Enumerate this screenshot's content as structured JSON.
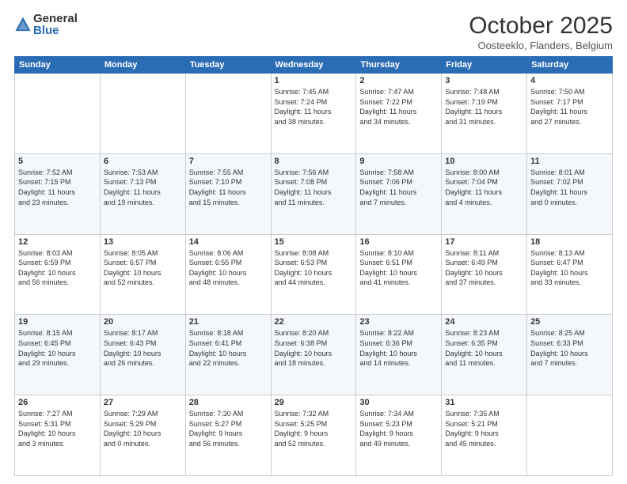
{
  "logo": {
    "general": "General",
    "blue": "Blue"
  },
  "header": {
    "month": "October 2025",
    "location": "Oosteeklo, Flanders, Belgium"
  },
  "weekdays": [
    "Sunday",
    "Monday",
    "Tuesday",
    "Wednesday",
    "Thursday",
    "Friday",
    "Saturday"
  ],
  "weeks": [
    [
      {
        "day": "",
        "info": ""
      },
      {
        "day": "",
        "info": ""
      },
      {
        "day": "",
        "info": ""
      },
      {
        "day": "1",
        "info": "Sunrise: 7:45 AM\nSunset: 7:24 PM\nDaylight: 11 hours\nand 38 minutes."
      },
      {
        "day": "2",
        "info": "Sunrise: 7:47 AM\nSunset: 7:22 PM\nDaylight: 11 hours\nand 34 minutes."
      },
      {
        "day": "3",
        "info": "Sunrise: 7:48 AM\nSunset: 7:19 PM\nDaylight: 11 hours\nand 31 minutes."
      },
      {
        "day": "4",
        "info": "Sunrise: 7:50 AM\nSunset: 7:17 PM\nDaylight: 11 hours\nand 27 minutes."
      }
    ],
    [
      {
        "day": "5",
        "info": "Sunrise: 7:52 AM\nSunset: 7:15 PM\nDaylight: 11 hours\nand 23 minutes."
      },
      {
        "day": "6",
        "info": "Sunrise: 7:53 AM\nSunset: 7:13 PM\nDaylight: 11 hours\nand 19 minutes."
      },
      {
        "day": "7",
        "info": "Sunrise: 7:55 AM\nSunset: 7:10 PM\nDaylight: 11 hours\nand 15 minutes."
      },
      {
        "day": "8",
        "info": "Sunrise: 7:56 AM\nSunset: 7:08 PM\nDaylight: 11 hours\nand 11 minutes."
      },
      {
        "day": "9",
        "info": "Sunrise: 7:58 AM\nSunset: 7:06 PM\nDaylight: 11 hours\nand 7 minutes."
      },
      {
        "day": "10",
        "info": "Sunrise: 8:00 AM\nSunset: 7:04 PM\nDaylight: 11 hours\nand 4 minutes."
      },
      {
        "day": "11",
        "info": "Sunrise: 8:01 AM\nSunset: 7:02 PM\nDaylight: 11 hours\nand 0 minutes."
      }
    ],
    [
      {
        "day": "12",
        "info": "Sunrise: 8:03 AM\nSunset: 6:59 PM\nDaylight: 10 hours\nand 56 minutes."
      },
      {
        "day": "13",
        "info": "Sunrise: 8:05 AM\nSunset: 6:57 PM\nDaylight: 10 hours\nand 52 minutes."
      },
      {
        "day": "14",
        "info": "Sunrise: 8:06 AM\nSunset: 6:55 PM\nDaylight: 10 hours\nand 48 minutes."
      },
      {
        "day": "15",
        "info": "Sunrise: 8:08 AM\nSunset: 6:53 PM\nDaylight: 10 hours\nand 44 minutes."
      },
      {
        "day": "16",
        "info": "Sunrise: 8:10 AM\nSunset: 6:51 PM\nDaylight: 10 hours\nand 41 minutes."
      },
      {
        "day": "17",
        "info": "Sunrise: 8:11 AM\nSunset: 6:49 PM\nDaylight: 10 hours\nand 37 minutes."
      },
      {
        "day": "18",
        "info": "Sunrise: 8:13 AM\nSunset: 6:47 PM\nDaylight: 10 hours\nand 33 minutes."
      }
    ],
    [
      {
        "day": "19",
        "info": "Sunrise: 8:15 AM\nSunset: 6:45 PM\nDaylight: 10 hours\nand 29 minutes."
      },
      {
        "day": "20",
        "info": "Sunrise: 8:17 AM\nSunset: 6:43 PM\nDaylight: 10 hours\nand 26 minutes."
      },
      {
        "day": "21",
        "info": "Sunrise: 8:18 AM\nSunset: 6:41 PM\nDaylight: 10 hours\nand 22 minutes."
      },
      {
        "day": "22",
        "info": "Sunrise: 8:20 AM\nSunset: 6:38 PM\nDaylight: 10 hours\nand 18 minutes."
      },
      {
        "day": "23",
        "info": "Sunrise: 8:22 AM\nSunset: 6:36 PM\nDaylight: 10 hours\nand 14 minutes."
      },
      {
        "day": "24",
        "info": "Sunrise: 8:23 AM\nSunset: 6:35 PM\nDaylight: 10 hours\nand 11 minutes."
      },
      {
        "day": "25",
        "info": "Sunrise: 8:25 AM\nSunset: 6:33 PM\nDaylight: 10 hours\nand 7 minutes."
      }
    ],
    [
      {
        "day": "26",
        "info": "Sunrise: 7:27 AM\nSunset: 5:31 PM\nDaylight: 10 hours\nand 3 minutes."
      },
      {
        "day": "27",
        "info": "Sunrise: 7:29 AM\nSunset: 5:29 PM\nDaylight: 10 hours\nand 0 minutes."
      },
      {
        "day": "28",
        "info": "Sunrise: 7:30 AM\nSunset: 5:27 PM\nDaylight: 9 hours\nand 56 minutes."
      },
      {
        "day": "29",
        "info": "Sunrise: 7:32 AM\nSunset: 5:25 PM\nDaylight: 9 hours\nand 52 minutes."
      },
      {
        "day": "30",
        "info": "Sunrise: 7:34 AM\nSunset: 5:23 PM\nDaylight: 9 hours\nand 49 minutes."
      },
      {
        "day": "31",
        "info": "Sunrise: 7:35 AM\nSunset: 5:21 PM\nDaylight: 9 hours\nand 45 minutes."
      },
      {
        "day": "",
        "info": ""
      }
    ]
  ]
}
